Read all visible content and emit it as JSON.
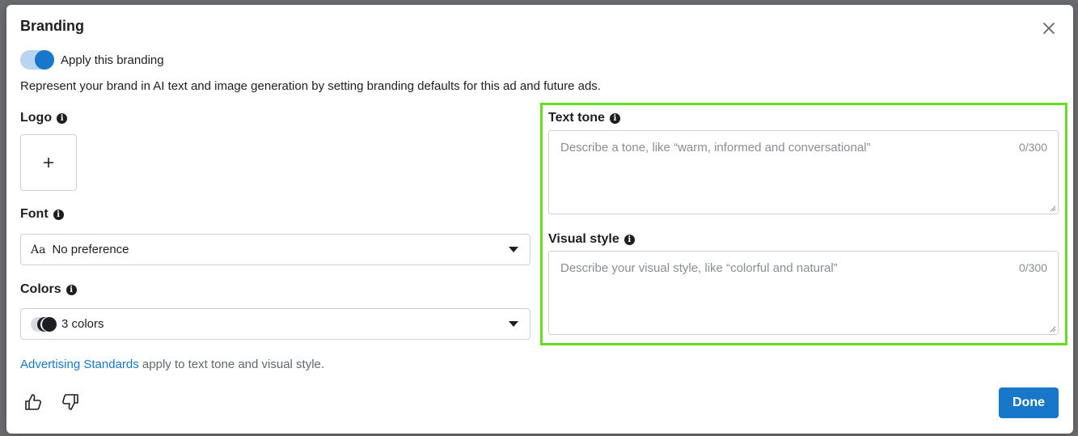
{
  "dialog": {
    "title": "Branding",
    "close_icon": "close-icon",
    "toggle": {
      "label": "Apply this branding",
      "on": true,
      "color": "#1877c8"
    },
    "description": "Represent your brand in AI text and image generation by setting branding defaults for this ad and future ads.",
    "logo": {
      "label": "Logo",
      "add_icon": "plus-icon"
    },
    "font": {
      "label": "Font",
      "value": "No preference",
      "icon": "font-aa-icon",
      "icon_text": "Aa"
    },
    "colors": {
      "label": "Colors",
      "value": "3 colors",
      "icon": "color-swatches-icon"
    },
    "text_tone": {
      "label": "Text tone",
      "placeholder": "Describe a tone, like “warm, informed and conversational”",
      "counter": "0/300"
    },
    "visual_style": {
      "label": "Visual style",
      "placeholder": "Describe your visual style, like “colorful and natural”",
      "counter": "0/300"
    },
    "footnote": {
      "link": "Advertising Standards",
      "rest": " apply to text tone and visual style."
    },
    "feedback": {
      "thumbs_up_icon": "thumbs-up-icon",
      "thumbs_down_icon": "thumbs-down-icon"
    },
    "done_label": "Done",
    "highlight_color": "#66dd22",
    "info_glyph": "i"
  }
}
